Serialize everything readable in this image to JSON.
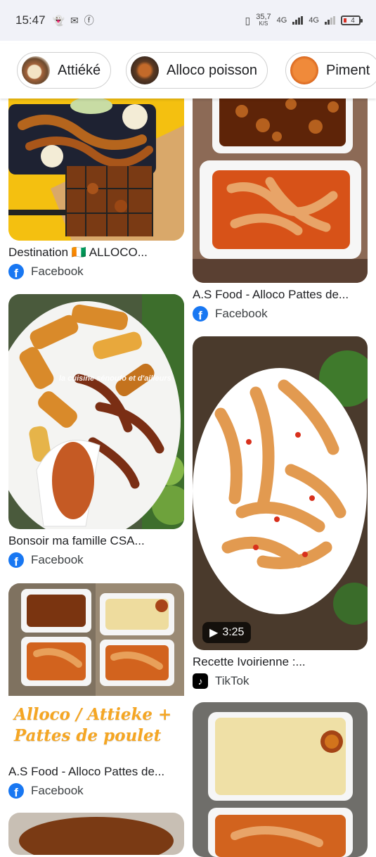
{
  "status_bar": {
    "time": "15:47",
    "speed": "35,7",
    "speed_unit": "K/S",
    "net1": "4G",
    "net2": "4G",
    "battery": "4"
  },
  "chips": [
    {
      "label": "Attiéké"
    },
    {
      "label": "Alloco poisson"
    },
    {
      "label": "Piment"
    }
  ],
  "results": [
    {
      "title": "Destination 🇨🇮 ALLOCO...",
      "source": "Facebook"
    },
    {
      "title": "A.S Food - Alloco Pattes de...",
      "source": "Facebook"
    },
    {
      "title": "Bonsoir ma famille CSA...",
      "source": "Facebook",
      "image_text": "la cuisine sénoufo et d'ailleurs"
    },
    {
      "title": "Recette Ivoirienne :...",
      "source": "TikTok",
      "duration": "3:25"
    },
    {
      "title": "A.S Food - Alloco Pattes de...",
      "source": "Facebook",
      "image_text_1": "Alloco / Attieke +",
      "image_text_2": "Pattes de poulet"
    }
  ],
  "colors": {
    "facebook": "#1877f2",
    "tiktok": "#000000",
    "statusbar_bg": "#f1f2f8"
  }
}
